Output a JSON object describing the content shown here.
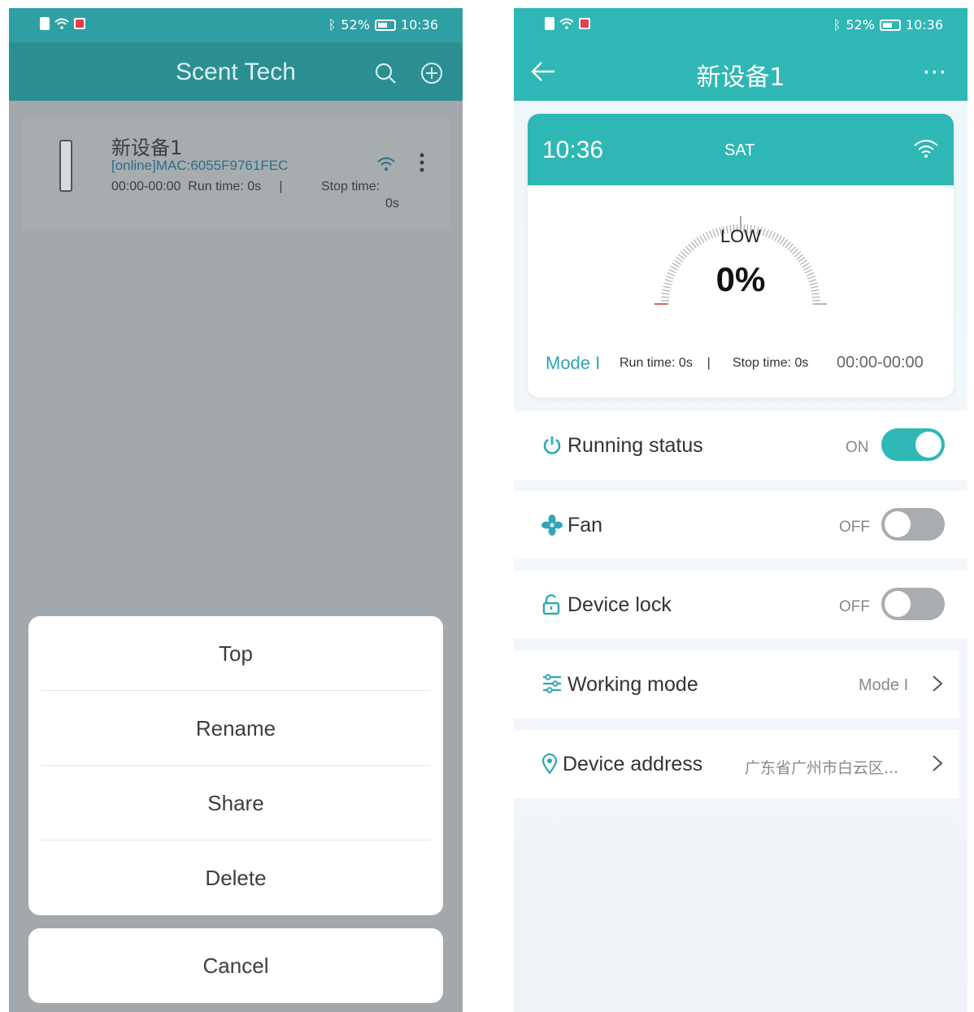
{
  "left": {
    "status": {
      "battery": "52%",
      "time": "10:36"
    },
    "title": "Scent Tech",
    "device": {
      "name": "新设备1",
      "mac": "[online]MAC:6055F9761FEC",
      "schedule": "00:00-00:00",
      "run_time": "Run time:  0s",
      "separator": "|",
      "stop_label": "Stop time:",
      "stop_value": "0s"
    },
    "sheet": [
      "Top",
      "Rename",
      "Share",
      "Delete"
    ],
    "cancel": "Cancel"
  },
  "right": {
    "status": {
      "battery": "52%",
      "time": "10:36"
    },
    "title": "新设备1",
    "card": {
      "time": "10:36",
      "day": "SAT",
      "level": "LOW",
      "percent_text": "0%",
      "percent": 0,
      "mode": "Mode I",
      "run_time": "Run time:  0s",
      "separator": "|",
      "stop_time": "Stop time:  0s",
      "range": "00:00-00:00"
    },
    "rows": {
      "running": {
        "label": "Running status",
        "state": "ON"
      },
      "fan": {
        "label": "Fan",
        "state": "OFF"
      },
      "lock": {
        "label": "Device lock",
        "state": "OFF"
      },
      "mode": {
        "label": "Working mode",
        "value": "Mode I"
      },
      "address": {
        "label": "Device address",
        "value": "广东省广州市白云区..."
      }
    },
    "colors": {
      "accent": "#2fb7b5",
      "header_dark": "#2b8f91"
    }
  }
}
